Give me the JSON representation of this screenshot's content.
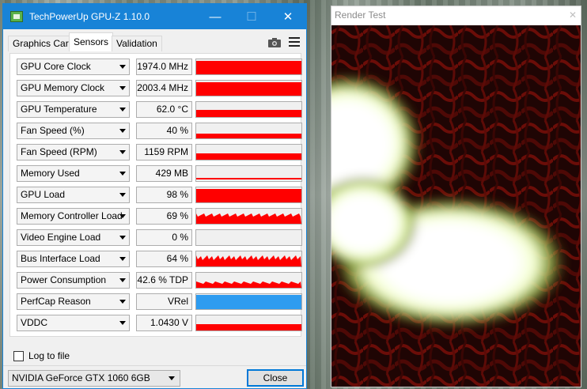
{
  "gpuz": {
    "title": "TechPowerUp GPU-Z 1.10.0",
    "window_buttons": {
      "minimize": "—",
      "maximize": "☐",
      "close": "✕"
    },
    "tabs": [
      {
        "label": "Graphics Card",
        "active": false
      },
      {
        "label": "Sensors",
        "active": true
      },
      {
        "label": "Validation",
        "active": false
      }
    ],
    "sensors": [
      {
        "name": "GPU Core Clock",
        "value": "1974.0 MHz",
        "graph": "full"
      },
      {
        "name": "GPU Memory Clock",
        "value": "2003.4 MHz",
        "graph": "full"
      },
      {
        "name": "GPU Temperature",
        "value": "62.0 °C",
        "graph": "high"
      },
      {
        "name": "Fan Speed (%)",
        "value": "40 %",
        "graph": "low"
      },
      {
        "name": "Fan Speed (RPM)",
        "value": "1159 RPM",
        "graph": "mid"
      },
      {
        "name": "Memory Used",
        "value": "429 MB",
        "graph": "line"
      },
      {
        "name": "GPU Load",
        "value": "98 %",
        "graph": "full"
      },
      {
        "name": "Memory Controller Load",
        "value": "69 %",
        "graph": "noisy"
      },
      {
        "name": "Video Engine Load",
        "value": "0 %",
        "graph": "empty"
      },
      {
        "name": "Bus Interface Load",
        "value": "64 %",
        "graph": "spiky"
      },
      {
        "name": "Power Consumption",
        "value": "42.6 % TDP",
        "graph": "low-noisy"
      },
      {
        "name": "PerfCap Reason",
        "value": "VRel",
        "graph": "blue"
      },
      {
        "name": "VDDC",
        "value": "1.0430 V",
        "graph": "mid"
      }
    ],
    "log_to_file": "Log to file",
    "gpu_select": "NVIDIA GeForce GTX 1060 6GB",
    "close_button": "Close",
    "colors": {
      "graph": "#ff0000",
      "perfcap": "#2e9cf0",
      "titlebar": "#1883d7"
    }
  },
  "render_test": {
    "title": "Render Test",
    "close_icon": "✕"
  }
}
